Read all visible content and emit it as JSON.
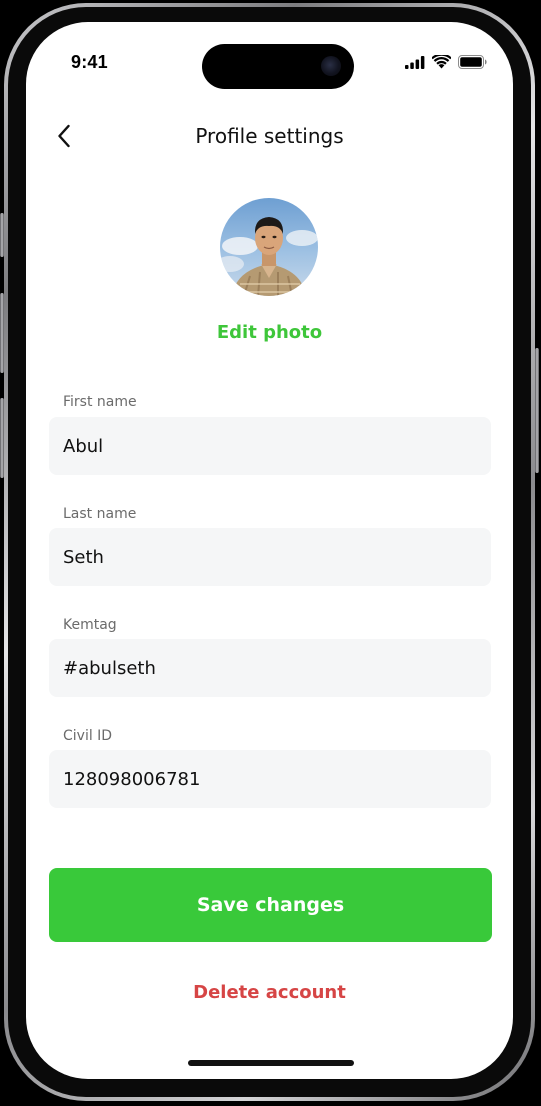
{
  "status_bar": {
    "time": "9:41",
    "icons": [
      "cellular-signal-icon",
      "wifi-icon",
      "battery-icon"
    ]
  },
  "nav": {
    "title": "Profile settings",
    "back_icon": "chevron-left-icon"
  },
  "profile": {
    "avatar_alt": "profile-photo",
    "edit_photo_label": "Edit photo"
  },
  "form": {
    "fields": [
      {
        "label": "First name",
        "value": "Abul"
      },
      {
        "label": "Last name",
        "value": "Seth"
      },
      {
        "label": "Kemtag",
        "value": "#abulseth"
      },
      {
        "label": "Civil ID",
        "value": "128098006781"
      }
    ]
  },
  "actions": {
    "save_label": "Save changes",
    "delete_label": "Delete account"
  },
  "colors": {
    "accent_green": "#39c93a",
    "danger_red": "#d64545",
    "field_bg": "#f5f6f7",
    "label_gray": "#6b6b6b"
  }
}
